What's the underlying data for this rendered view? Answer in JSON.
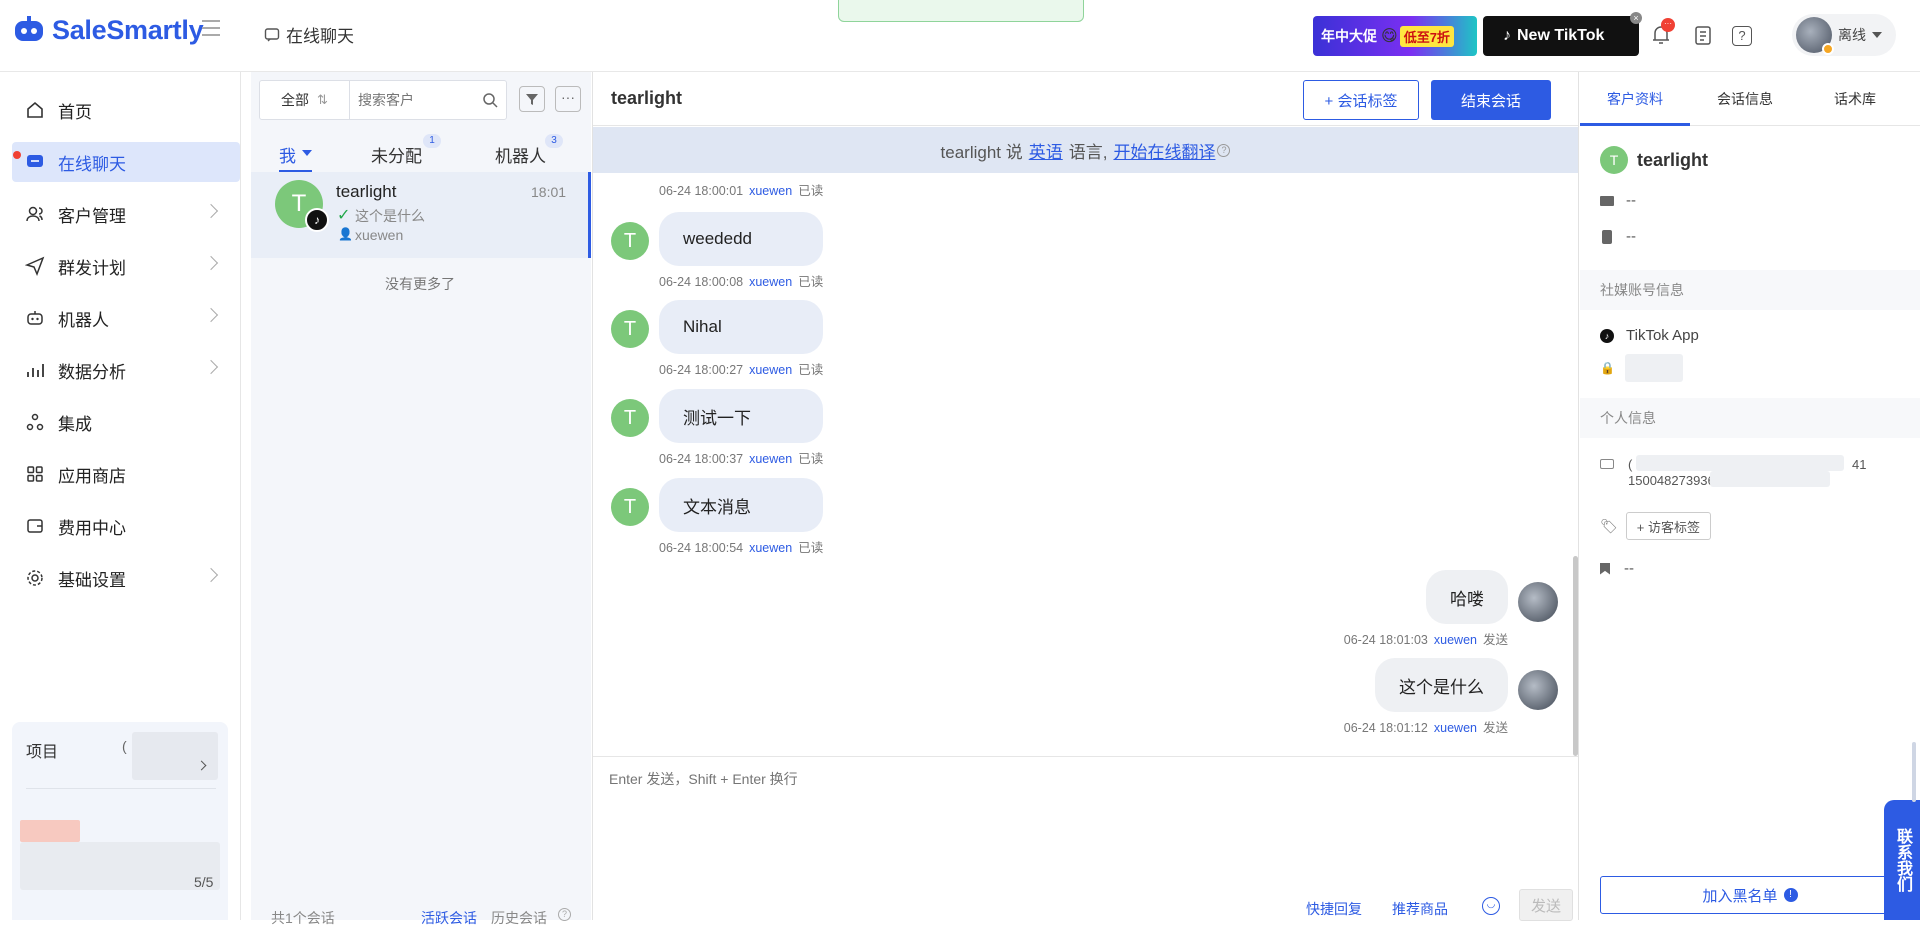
{
  "app": {
    "name": "SaleSmartly"
  },
  "header": {
    "page_title": "在线聊天",
    "banner1": "年中大促",
    "banner1_sub": "低至7折",
    "banner2": "New TikTok",
    "notify_badge": "···",
    "status": "离线"
  },
  "sidebar": {
    "items": [
      {
        "label": "首页"
      },
      {
        "label": "在线聊天"
      },
      {
        "label": "客户管理"
      },
      {
        "label": "群发计划"
      },
      {
        "label": "机器人"
      },
      {
        "label": "数据分析"
      },
      {
        "label": "集成"
      },
      {
        "label": "应用商店"
      },
      {
        "label": "费用中心"
      },
      {
        "label": "基础设置"
      }
    ],
    "project_label": "项目",
    "project_value": "(",
    "quota": "5/5"
  },
  "convlist": {
    "filter_all": "全部",
    "search_placeholder": "搜索客户",
    "tabs": [
      {
        "label": "我"
      },
      {
        "label": "未分配",
        "badge": "1"
      },
      {
        "label": "机器人",
        "badge": "3"
      }
    ],
    "item": {
      "avatar": "T",
      "name": "tearlight",
      "time": "18:01",
      "preview": "这个是什么",
      "agent": "xuewen"
    },
    "no_more": "没有更多了",
    "footer_count": "共1个会话",
    "footer_active": "活跃会话",
    "footer_history": "历史会话"
  },
  "chat": {
    "title": "tearlight",
    "tag_button": "+ 会话标签",
    "end_button": "结束会话",
    "translate_prefix": "tearlight 说",
    "translate_lang": "英语",
    "translate_mid": "语言,",
    "translate_link": "开始在线翻译",
    "top_meta_time": "06-24 18:00:01",
    "agent": "xuewen",
    "read": "已读",
    "sent": "发送",
    "messages_in": [
      {
        "text": "weededd",
        "time": "06-24 18:00:08"
      },
      {
        "text": "Nihal",
        "time": "06-24 18:00:27"
      },
      {
        "text": "测试一下",
        "time": "06-24 18:00:37"
      },
      {
        "text": "文本消息",
        "time": "06-24 18:00:54"
      }
    ],
    "messages_out": [
      {
        "text": "哈喽",
        "time": "06-24 18:01:03"
      },
      {
        "text": "这个是什么",
        "time": "06-24 18:01:12"
      }
    ],
    "input_placeholder": "Enter 发送，Shift + Enter 换行",
    "quick_reply": "快捷回复",
    "recommend": "推荐商品",
    "send_button": "发送"
  },
  "right": {
    "tabs": [
      {
        "label": "客户资料"
      },
      {
        "label": "会话信息"
      },
      {
        "label": "话术库"
      }
    ],
    "avatar": "T",
    "name": "tearlight",
    "email": "--",
    "phone": "--",
    "social_header": "社媒账号信息",
    "social_app": "TikTok App",
    "personal_header": "个人信息",
    "id_partial_start": "(",
    "id_partial_end": "41",
    "id_line2": "15004827393б",
    "visitor_tag": "+ 访客标签",
    "note": "--",
    "blacklist": "加入黑名单",
    "contact_us": "联系我们"
  },
  "colors": {
    "accent": "#2d5be3",
    "avatar_green": "#7cc87a",
    "active_bg": "#dde6fb"
  }
}
